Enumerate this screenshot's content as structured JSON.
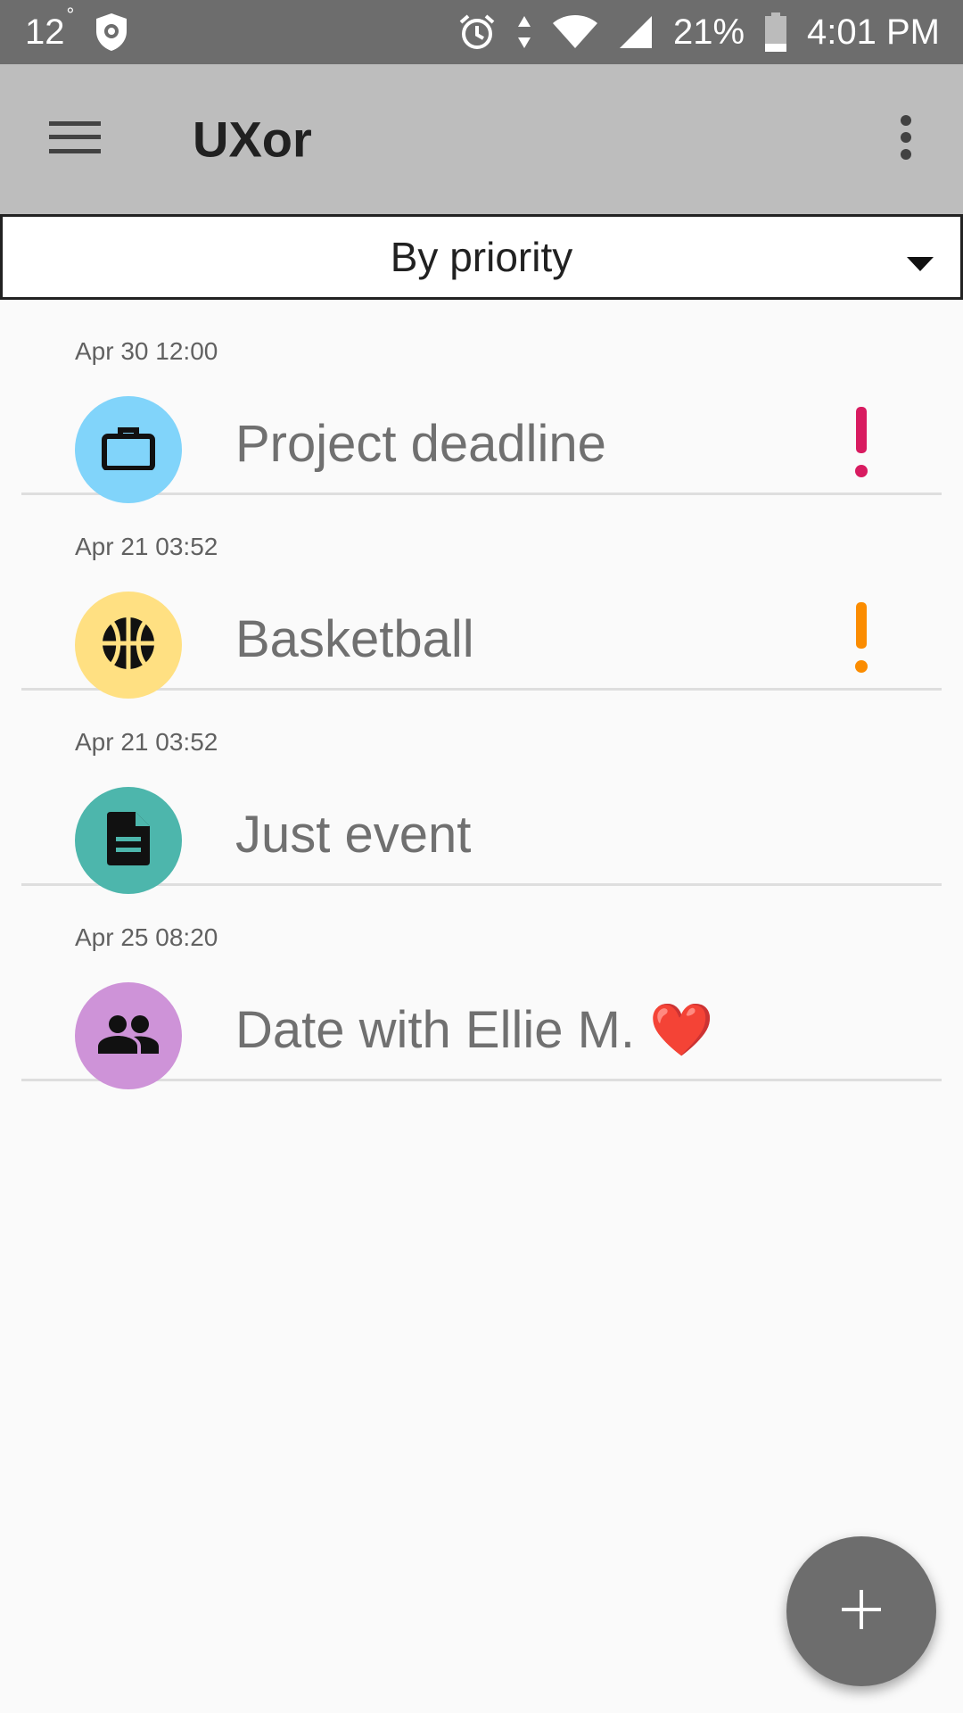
{
  "status_bar": {
    "temperature": "12",
    "temperature_unit": "°",
    "battery": "21%",
    "time": "4:01 PM",
    "icons": [
      "shield-icon",
      "alarm-icon",
      "data-arrows-icon",
      "wifi-icon",
      "cell-signal-icon",
      "battery-icon"
    ]
  },
  "app_bar": {
    "title": "UXor",
    "icons": [
      "menu-icon",
      "more-vert-icon"
    ]
  },
  "sort": {
    "selected": "By priority",
    "icon": "dropdown-arrow-icon"
  },
  "events": [
    {
      "date": "Apr 30 12:00",
      "title": "Project deadline",
      "icon": "briefcase-icon",
      "avatar_color": "#81d4fa",
      "priority": "high",
      "priority_color": "#d81b60"
    },
    {
      "date": "Apr 21 03:52",
      "title": "Basketball",
      "icon": "basketball-icon",
      "avatar_color": "#ffe082",
      "priority": "medium",
      "priority_color": "#fb8c00"
    },
    {
      "date": "Apr 21 03:52",
      "title": "Just event",
      "icon": "document-icon",
      "avatar_color": "#4db6ac",
      "priority": "none"
    },
    {
      "date": "Apr 25 08:20",
      "title": "Date with Ellie M. ❤️",
      "icon": "people-icon",
      "avatar_color": "#ce93d8",
      "priority": "none"
    }
  ],
  "fab": {
    "icon": "plus-icon",
    "color": "#6d6d6d"
  },
  "colors": {
    "status_bar": "#6d6d6d",
    "app_bar": "#bdbdbd",
    "background": "#fafafa"
  }
}
